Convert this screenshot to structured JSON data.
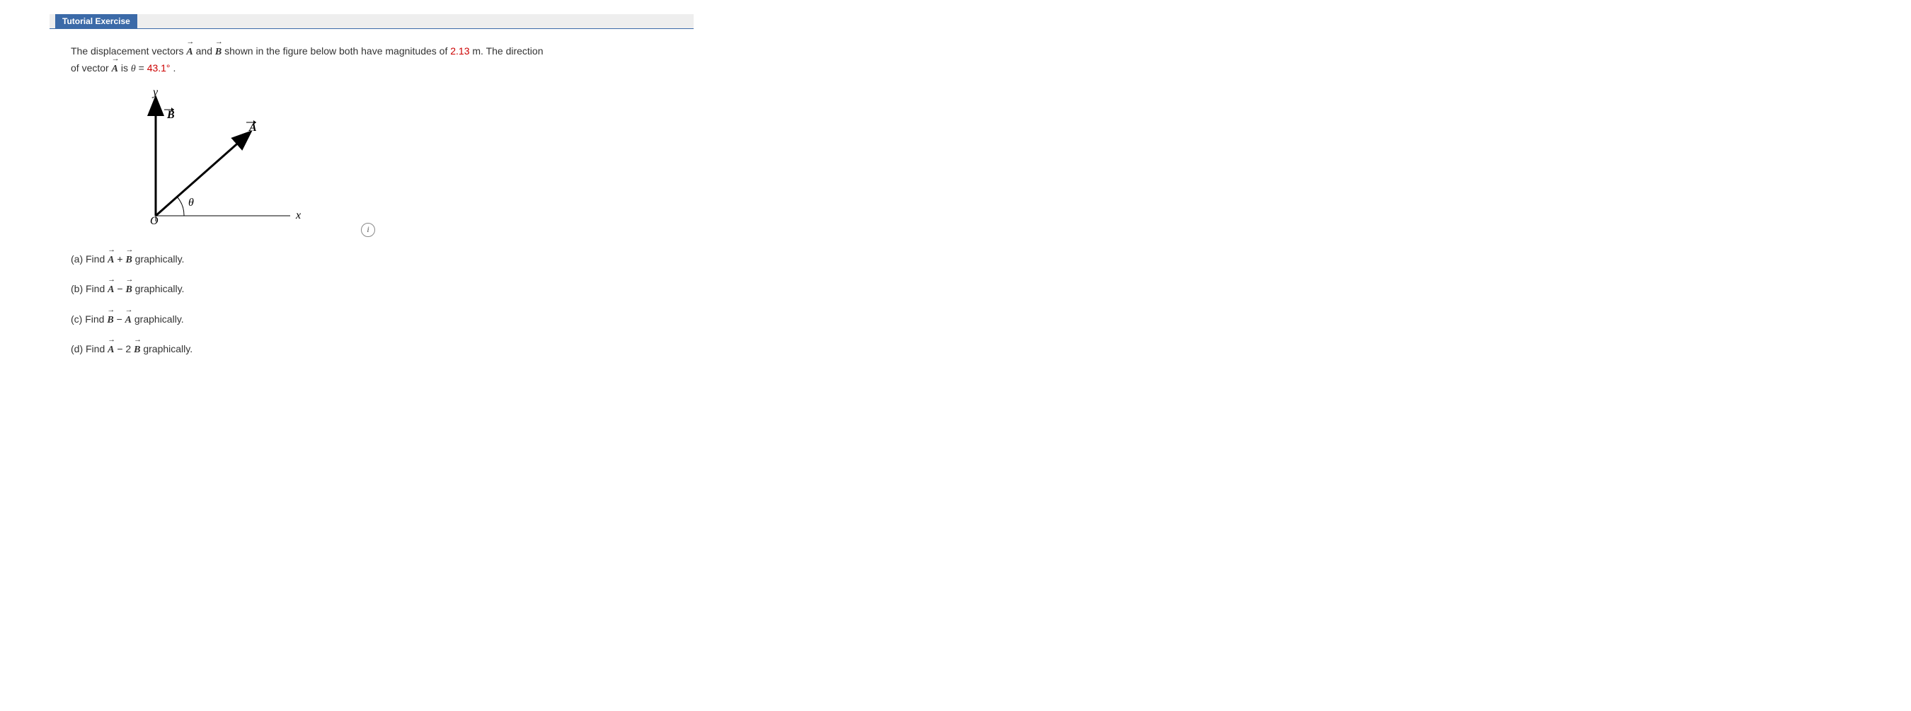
{
  "tab_title": "Tutorial Exercise",
  "problem": {
    "line1_pre": "The displacement vectors ",
    "vec_a": "A",
    "line1_mid": " and ",
    "vec_b": "B",
    "line1_post": " shown in the figure below both have magnitudes of ",
    "magnitude": "2.13",
    "line1_end": " m. The direction",
    "line2_pre": "of vector ",
    "line2_mid": " is ",
    "theta": "θ",
    "equals": " = ",
    "angle": "43.1°",
    "period": "."
  },
  "figure": {
    "origin": "O",
    "x_label": "x",
    "y_label": "y",
    "a_label": "A",
    "b_label": "B",
    "theta_label": "θ"
  },
  "parts": {
    "a": {
      "label": "(a) Find ",
      "expr_left": "A",
      "op": " + ",
      "expr_right": "B",
      "tail": " graphically."
    },
    "b": {
      "label": "(b) Find ",
      "expr_left": "A",
      "op": " − ",
      "expr_right": "B",
      "tail": " graphically."
    },
    "c": {
      "label": "(c) Find ",
      "expr_left": "B",
      "op": " − ",
      "expr_right": "A",
      "tail": " graphically."
    },
    "d": {
      "label": "(d) Find ",
      "expr_left": "A",
      "op": " − 2",
      "expr_right": "B",
      "tail": " graphically."
    }
  }
}
